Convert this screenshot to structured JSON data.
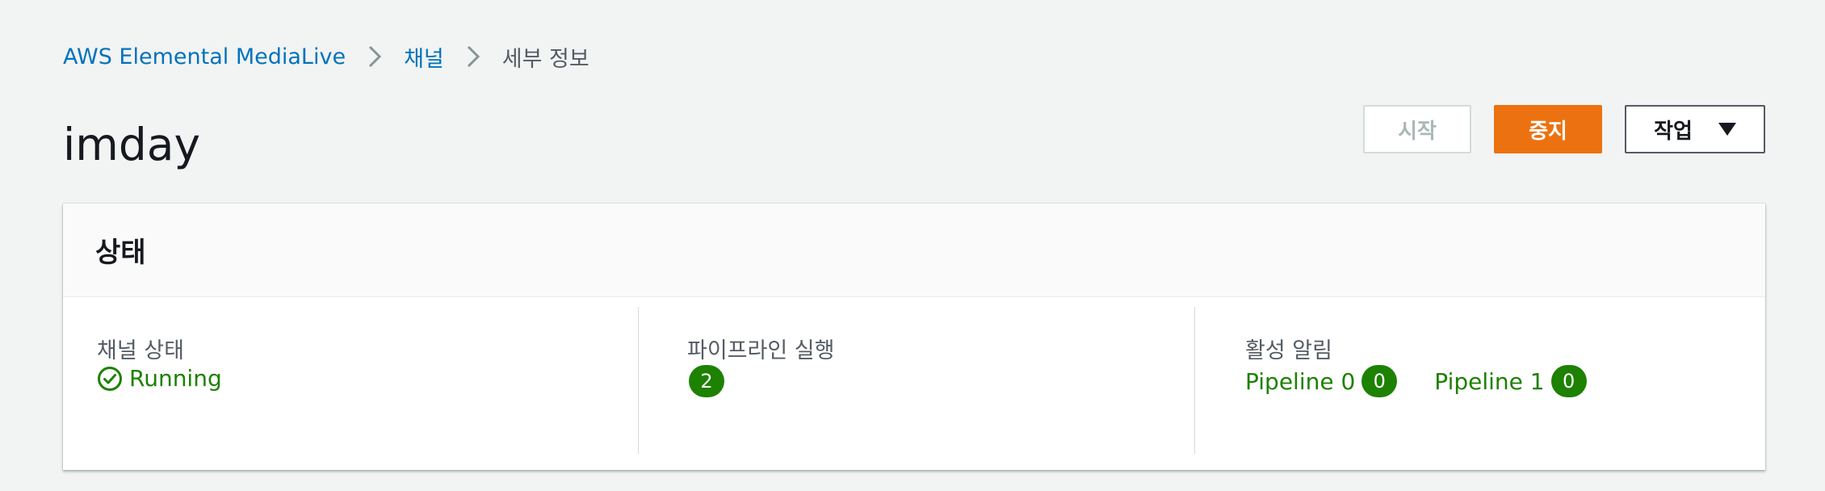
{
  "breadcrumb": {
    "service": "AWS Elemental MediaLive",
    "channels": "채널",
    "current": "세부 정보"
  },
  "page": {
    "title": "imday"
  },
  "actions": {
    "start_label": "시작",
    "stop_label": "중지",
    "actions_label": "작업"
  },
  "status_panel": {
    "title": "상태",
    "channel_state": {
      "label": "채널 상태",
      "value": "Running",
      "icon": "check-circle-icon"
    },
    "pipelines_running": {
      "label": "파이프라인 실행",
      "count": "2"
    },
    "active_alarms": {
      "label": "활성 알림",
      "pipelines": [
        {
          "name": "Pipeline 0",
          "count": "0"
        },
        {
          "name": "Pipeline 1",
          "count": "0"
        }
      ]
    }
  },
  "colors": {
    "link": "#0073bb",
    "primary_button": "#ec7211",
    "success": "#1d8102",
    "background": "#f2f3f3"
  }
}
